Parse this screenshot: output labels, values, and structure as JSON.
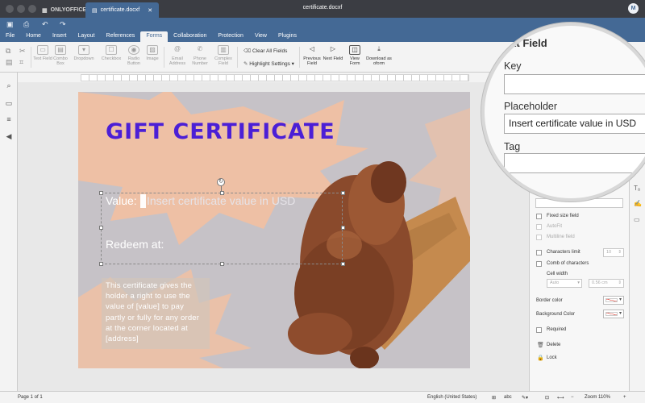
{
  "app": {
    "brand": "ONLYOFFICE",
    "doc_tab": "certificate.docxf",
    "window_title": "certificate.docxf",
    "avatar": "M"
  },
  "menu": [
    "File",
    "Home",
    "Insert",
    "Layout",
    "References",
    "Forms",
    "Collaboration",
    "Protection",
    "View",
    "Plugins"
  ],
  "menu_active": "Forms",
  "ribbon": {
    "text_field": "Text Field",
    "combo_box": "Combo Box",
    "dropdown": "Dropdown",
    "checkbox": "Checkbox",
    "radio_button": "Radio Button",
    "image": "Image",
    "email": "Email Address",
    "phone": "Phone Number",
    "complex": "Complex Field",
    "clear_fields": "Clear All Fields",
    "highlight": "Highlight Settings",
    "previous_field": "Previous Field",
    "next_field": "Next Field",
    "view_form": "View Form",
    "download": "Download as oform"
  },
  "document": {
    "title": "GIFT CERTIFICATE",
    "value_label": "Value:",
    "value_placeholder": "Insert certificate value in USD",
    "redeem_label": "Redeem at:",
    "body": "This certificate gives the holder a right to use the value of [value] to pay partly or fully for any order at the corner located at [address]"
  },
  "panel": {
    "heading": "Text Field",
    "key_label": "Key",
    "key_value": "",
    "placeholder_label": "Placeholder",
    "placeholder_value": "Insert certificate value in USD",
    "tag_label": "Tag",
    "tag_value": "",
    "fixed_size": "Fixed size field",
    "autofit": "AutoFit",
    "multiline": "Multiline field",
    "char_limit": "Characters limit",
    "char_limit_value": "10",
    "comb": "Comb of characters",
    "cell_width": "Cell width",
    "cell_width_mode": "Auto",
    "cell_width_value": "0.56 cm",
    "border_color": "Border color",
    "background_color": "Background Color",
    "required": "Required",
    "delete": "Delete",
    "lock": "Lock"
  },
  "status": {
    "page": "Page 1 of 1",
    "language": "English (United States)",
    "zoom": "Zoom 110%"
  },
  "colors": {
    "accent": "#446995",
    "title_purple": "#4b1fd6",
    "burst_orange": "#f5c09f",
    "page_gray": "#c6c2c7"
  }
}
